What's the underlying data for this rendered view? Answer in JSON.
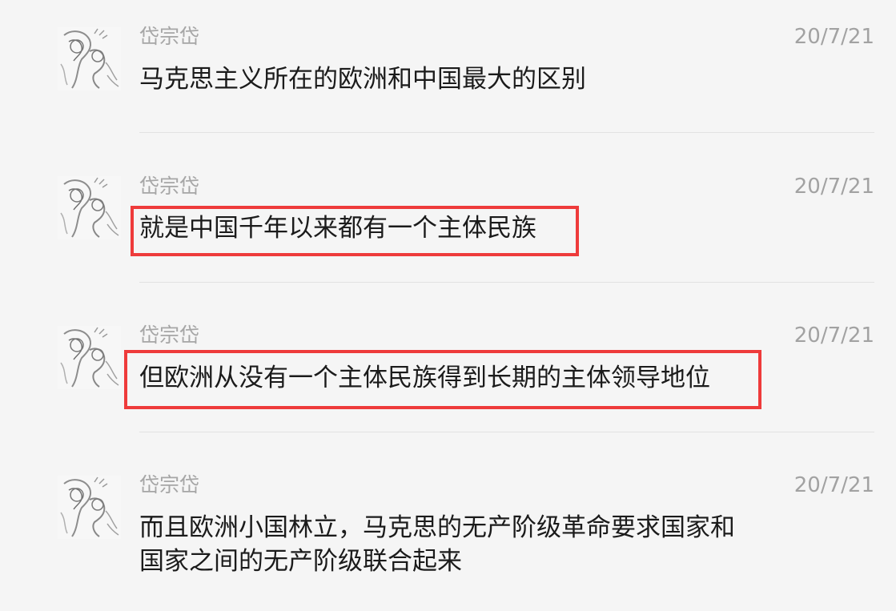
{
  "messages": [
    {
      "sender": "岱宗岱",
      "time": "20/7/21",
      "text": "马克思主义所在的欧洲和中国最大的区别",
      "highlighted": false
    },
    {
      "sender": "岱宗岱",
      "time": "20/7/21",
      "text": "就是中国千年以来都有一个主体民族",
      "highlighted": true
    },
    {
      "sender": "岱宗岱",
      "time": "20/7/21",
      "text": "但欧洲从没有一个主体民族得到长期的主体领导地位",
      "highlighted": true
    },
    {
      "sender": "岱宗岱",
      "time": "20/7/21",
      "text": "而且欧洲小国林立，马克思的无产阶级革命要求国家和国家之间的无产阶级联合起来",
      "highlighted": false
    }
  ],
  "colors": {
    "background": "#f5f5f5",
    "highlight_border": "#ee3b3b",
    "sender_text": "#a6a6a6",
    "message_text": "#1b1b1b",
    "divider": "#e2e2e2"
  },
  "icons": {
    "avatar": "sketch-anime-girl-avatar-icon"
  }
}
